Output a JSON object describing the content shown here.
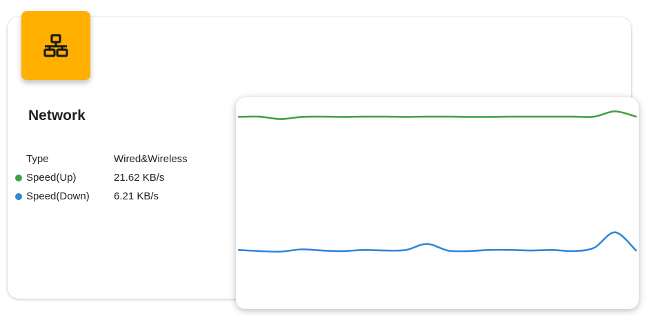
{
  "widget": {
    "title": "Network",
    "icon": "network-icon",
    "icon_color": "#ffb000"
  },
  "info": {
    "type_label": "Type",
    "type_value": "Wired&Wireless",
    "up_label": "Speed(Up)",
    "up_value": "21.62 KB/s",
    "up_color": "#43a047",
    "down_label": "Speed(Down)",
    "down_value": "6.21 KB/s",
    "down_color": "#2e86d6"
  },
  "chart_data": {
    "type": "line",
    "grid": false,
    "series": [
      {
        "color": "#43a047",
        "values": [
          21.5,
          21.6,
          20.5,
          21.5,
          21.6,
          21.5,
          21.6,
          21.6,
          21.5,
          21.6,
          21.6,
          21.5,
          21.5,
          21.6,
          21.6,
          21.6,
          21.6,
          21.6,
          24.0,
          21.62
        ]
      },
      {
        "color": "#2e86d6",
        "values": [
          6.3,
          6.1,
          6.0,
          6.4,
          6.2,
          6.1,
          6.3,
          6.2,
          6.3,
          7.4,
          6.2,
          6.1,
          6.3,
          6.3,
          6.2,
          6.3,
          6.1,
          6.7,
          9.5,
          6.21
        ]
      }
    ]
  }
}
